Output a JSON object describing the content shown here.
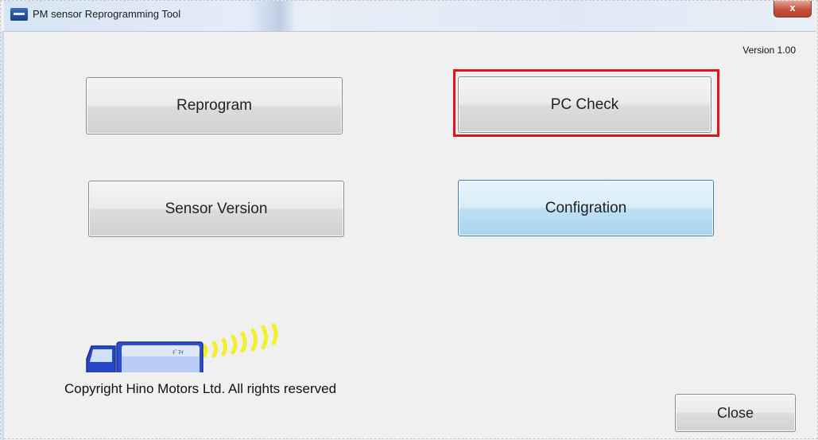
{
  "window": {
    "title": "PM sensor Reprogramming Tool",
    "close_glyph": "x"
  },
  "version_label": "Version 1.00",
  "buttons": {
    "reprogram": "Reprogram",
    "pc_check": "PC Check",
    "sensor_version": "Sensor Version",
    "configration": "Configration",
    "close": "Close"
  },
  "truck_badge": "ﾃﾞﾏｲ",
  "copyright": "Copyright Hino Motors Ltd. All rights reserved",
  "colors": {
    "highlight": "#e0141a",
    "focused_button_border": "#3c7fb1",
    "truck_body": "#1f3fbf",
    "signal_waves": "#f3ef2a"
  }
}
